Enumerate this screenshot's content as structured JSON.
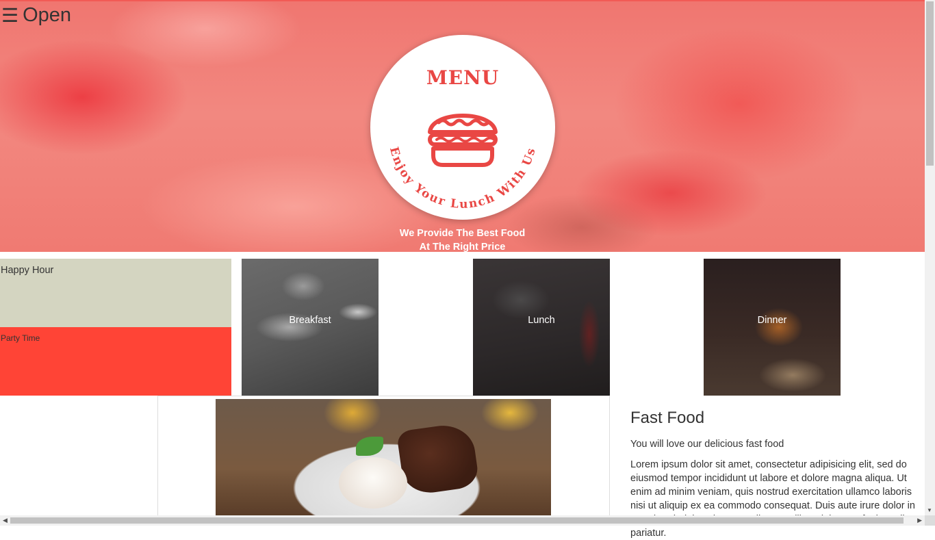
{
  "nav": {
    "open_icon": "☰",
    "open_label": "Open"
  },
  "hero": {
    "badge_title": "MENU",
    "badge_curve_text": "Enjoy Your Lunch With Us",
    "tagline_line1": "We Provide The Best Food",
    "tagline_line2": "At The Right Price"
  },
  "tiles": {
    "happy_hour": "Happy Hour",
    "party_time": "Party Time",
    "breakfast": "Breakfast",
    "lunch": "Lunch",
    "dinner": "Dinner"
  },
  "feature": {
    "title": "Fast Food",
    "subtitle": "You will love our delicious fast food",
    "body": "Lorem ipsum dolor sit amet, consectetur adipisicing elit, sed do eiusmod tempor incididunt ut labore et dolore magna aliqua. Ut enim ad minim veniam, quis nostrud exercitation ullamco laboris nisi ut aliquip ex ea commodo consequat. Duis aute irure dolor in reprehenderit in voluptate velit esse cillum dolore eu fugiat nulla pariatur."
  },
  "colors": {
    "accent": "#e94744",
    "party": "#ff4436",
    "happy": "#d4d5c1"
  },
  "icons": {
    "menu": "hamburger-icon",
    "logo": "burger-icon"
  }
}
